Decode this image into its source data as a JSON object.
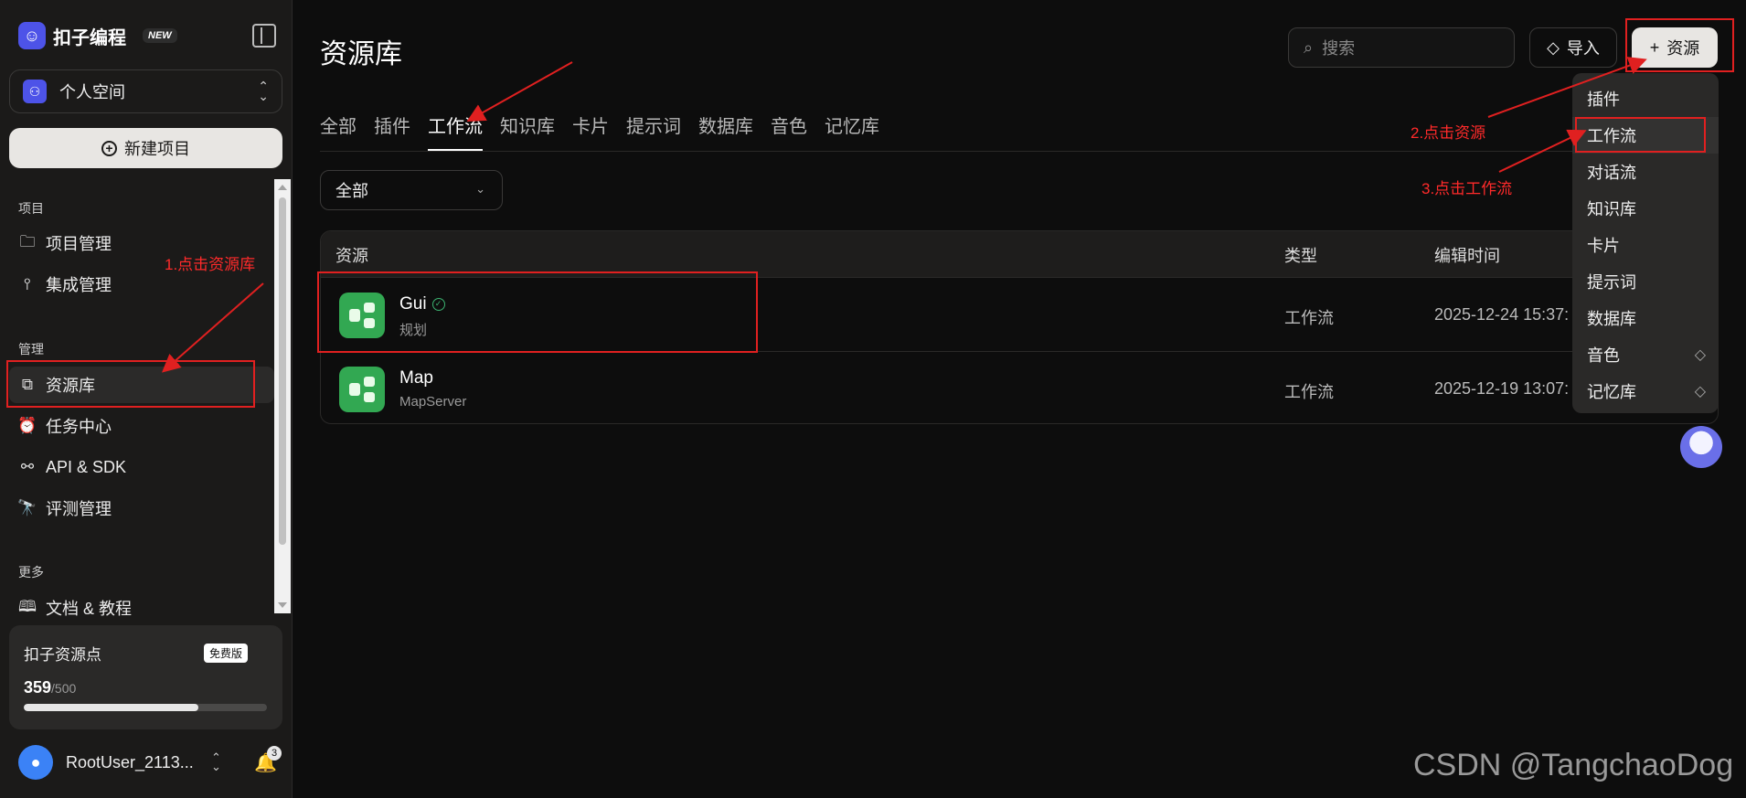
{
  "app": {
    "logo_name": "扣子编程",
    "new_badge": "NEW"
  },
  "space": {
    "avatar": "⚇",
    "label": "个人空间"
  },
  "sidebar": {
    "new_project": "新建项目",
    "sections": {
      "projects": "项目",
      "manage": "管理",
      "more": "更多"
    },
    "items": [
      {
        "label": "项目管理",
        "icon": "folder-icon"
      },
      {
        "label": "集成管理",
        "icon": "integration-icon"
      },
      {
        "label": "资源库",
        "icon": "resource-library-icon"
      },
      {
        "label": "任务中心",
        "icon": "alarm-icon"
      },
      {
        "label": "API & SDK",
        "icon": "api-icon"
      },
      {
        "label": "评测管理",
        "icon": "telescope-icon"
      },
      {
        "label": "文档 & 教程",
        "icon": "book-icon"
      }
    ]
  },
  "credits": {
    "title": "扣子资源点",
    "badge": "免费版",
    "value": "359",
    "total": "/500",
    "used_fraction": 0.718
  },
  "user": {
    "name": "RootUser_2113...",
    "notifications": "3"
  },
  "header": {
    "title": "资源库",
    "search_placeholder": "搜索",
    "import_label": "导入",
    "add_resource_label": "资源"
  },
  "tabs": [
    "全部",
    "插件",
    "工作流",
    "知识库",
    "卡片",
    "提示词",
    "数据库",
    "音色",
    "记忆库"
  ],
  "active_tab": "工作流",
  "filter": {
    "value": "全部"
  },
  "table": {
    "columns": [
      "资源",
      "类型",
      "编辑时间"
    ],
    "rows": [
      {
        "name": "Gui",
        "desc": "规划",
        "type": "工作流",
        "time": "2025-12-24 15:37:",
        "verified": true
      },
      {
        "name": "Map",
        "desc": "MapServer",
        "type": "工作流",
        "time": "2025-12-19 13:07:",
        "verified": false
      }
    ]
  },
  "dropdown": {
    "items": [
      {
        "label": "插件"
      },
      {
        "label": "工作流"
      },
      {
        "label": "对话流"
      },
      {
        "label": "知识库"
      },
      {
        "label": "卡片"
      },
      {
        "label": "提示词"
      },
      {
        "label": "数据库"
      },
      {
        "label": "音色",
        "premium": true
      },
      {
        "label": "记忆库",
        "premium": true
      }
    ]
  },
  "annotations": {
    "step1": "1.点击资源库",
    "step2": "2.点击资源",
    "step3": "3.点击工作流",
    "color": "#e02020"
  },
  "watermark": "CSDN @TangchaoDog"
}
